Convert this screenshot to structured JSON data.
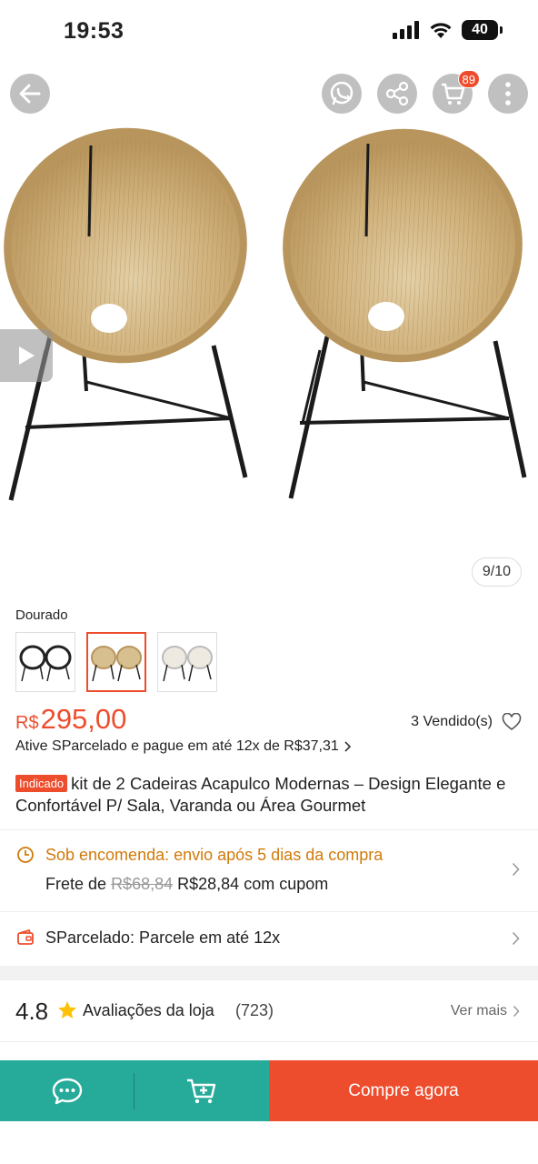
{
  "status_bar": {
    "time": "19:53",
    "battery": "40"
  },
  "header": {
    "cart_count": "89"
  },
  "gallery": {
    "counter": "9/10"
  },
  "variant": {
    "label": "Dourado",
    "options": [
      {
        "name": "Preto",
        "color": "#222222",
        "selected": false
      },
      {
        "name": "Dourado",
        "color": "#c9a774",
        "selected": true
      },
      {
        "name": "Branco",
        "color": "#d8d4cc",
        "selected": false
      }
    ]
  },
  "price": {
    "currency": "R$",
    "value": "295,00",
    "sold": "3 Vendido(s)",
    "installment": "Ative SParcelado e pague em até 12x de R$37,31"
  },
  "product": {
    "badge": "Indicado",
    "title": "kit de 2 Cadeiras Acapulco Modernas – Design Elegante e Confortável P/ Sala, Varanda ou Área Gourmet"
  },
  "shipping": {
    "title": "Sob encomenda: envio após 5 dias da compra",
    "freight_prefix": "Frete de",
    "freight_old": "R$68,84",
    "freight_new": "R$28,84 com cupom"
  },
  "sparcelado": {
    "text": "SParcelado: Parcele em até 12x"
  },
  "store_rating": {
    "value": "4.8",
    "label": "Avaliações da loja",
    "count": "(723)",
    "see_more": "Ver mais"
  },
  "bottom_bar": {
    "buy_now": "Compre agora"
  },
  "colors": {
    "accent": "#ee4d2d",
    "teal": "#26aa99",
    "shipping_orange": "#d07a0a"
  }
}
